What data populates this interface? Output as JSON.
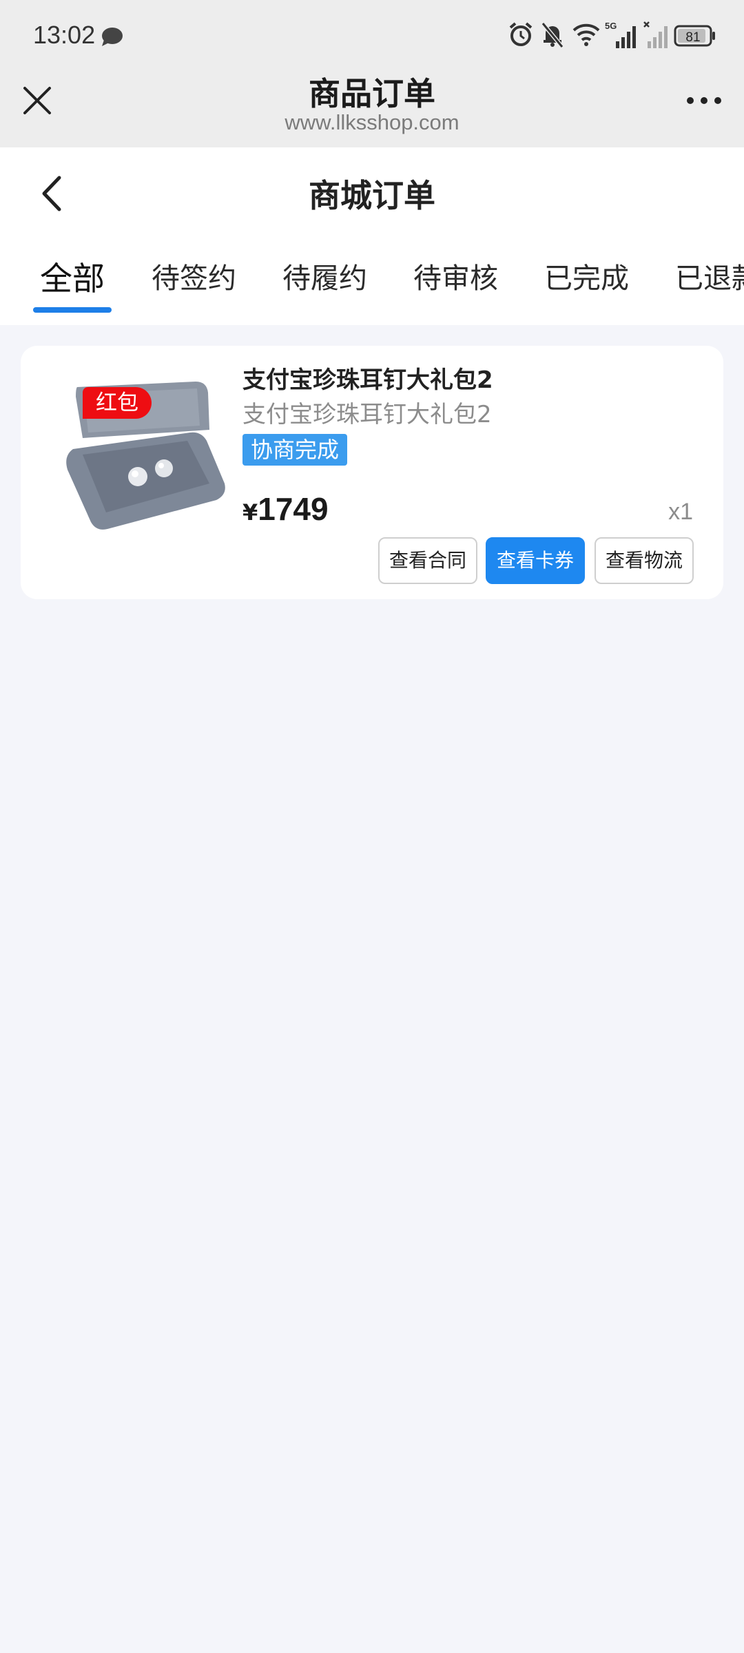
{
  "status_bar": {
    "time": "13:02",
    "network_label": "5G",
    "battery": "81",
    "icons": [
      "message-icon",
      "alarm-icon",
      "mute-icon",
      "wifi-icon",
      "signal-icon",
      "signal-icon",
      "battery-icon"
    ]
  },
  "browser": {
    "title": "商品订单",
    "url": "www.llksshop.com",
    "icons": [
      "close-icon",
      "more-icon"
    ]
  },
  "page": {
    "title": "商城订单",
    "back_icon": "back-icon"
  },
  "tabs": [
    {
      "label": "全部",
      "active": true
    },
    {
      "label": "待签约",
      "active": false
    },
    {
      "label": "待履约",
      "active": false
    },
    {
      "label": "待审核",
      "active": false
    },
    {
      "label": "已完成",
      "active": false
    },
    {
      "label": "已退款",
      "active": false
    }
  ],
  "orders": [
    {
      "badge": "红包",
      "title": "支付宝珍珠耳钉大礼包2",
      "subtitle": "支付宝珍珠耳钉大礼包2",
      "status": "协商完成",
      "currency": "¥",
      "price": "1749",
      "quantity": "x1",
      "actions": [
        {
          "label": "查看合同",
          "primary": false
        },
        {
          "label": "查看卡券",
          "primary": true
        },
        {
          "label": "查看物流",
          "primary": false
        }
      ]
    }
  ],
  "colors": {
    "accent": "#1e88f0",
    "tag": "#3b9cee",
    "badge": "#ee0d12",
    "background": "#f4f5fa"
  }
}
